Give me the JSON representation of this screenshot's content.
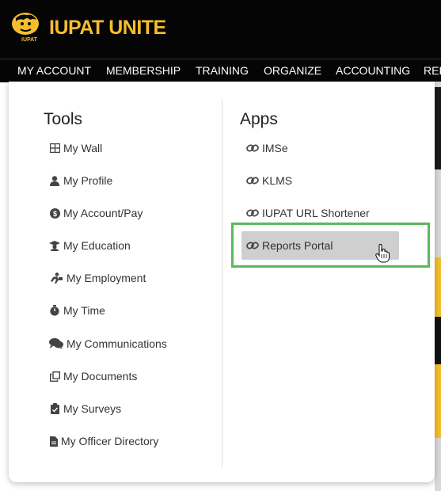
{
  "brand": {
    "title": "IUPAT UNITE",
    "subtitle": "IUPAT",
    "accent_color": "#f6be2d"
  },
  "nav": {
    "items": [
      "MY ACCOUNT",
      "MEMBERSHIP",
      "TRAINING",
      "ORGANIZE",
      "ACCOUNTING",
      "REP"
    ]
  },
  "tools": {
    "heading": "Tools",
    "items": [
      {
        "label": "My Wall",
        "icon": "grid-icon"
      },
      {
        "label": "My Profile",
        "icon": "user-icon"
      },
      {
        "label": "My Account/Pay",
        "icon": "dollar-circle-icon"
      },
      {
        "label": "My Education",
        "icon": "graduate-icon"
      },
      {
        "label": "My Employment",
        "icon": "worker-icon"
      },
      {
        "label": "My Time",
        "icon": "stopwatch-icon"
      },
      {
        "label": "My Communications",
        "icon": "comments-icon"
      },
      {
        "label": "My Documents",
        "icon": "copy-icon"
      },
      {
        "label": "My Surveys",
        "icon": "clipboard-icon"
      },
      {
        "label": "My Officer Directory",
        "icon": "file-icon"
      }
    ]
  },
  "apps": {
    "heading": "Apps",
    "items": [
      {
        "label": "IMSe",
        "icon": "link-icon"
      },
      {
        "label": "KLMS",
        "icon": "link-icon"
      },
      {
        "label": "IUPAT URL Shortener",
        "icon": "link-icon"
      },
      {
        "label": "Reports Portal",
        "icon": "link-icon",
        "hovered": true
      }
    ]
  },
  "highlight_color": "#5cb85c"
}
